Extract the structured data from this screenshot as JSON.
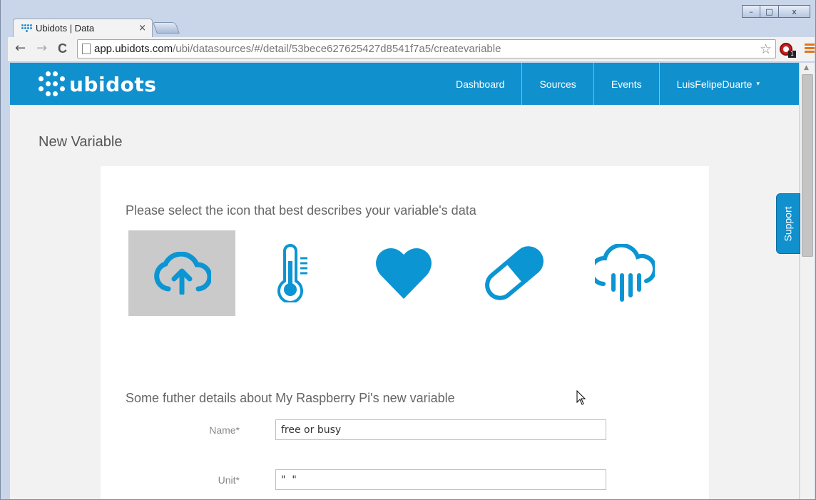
{
  "browser": {
    "tab_title": "Ubidots | Data",
    "tab_close": "×",
    "url_host": "app.ubidots.com",
    "url_path": "/ubi/datasources/#/detail/53bece627625427d8541f7a5/createvariable",
    "window_controls": {
      "minimize": "–",
      "maximize": "□",
      "close": "x"
    },
    "nav": {
      "back": "←",
      "forward": "→",
      "reload": "C"
    },
    "extension_badge": "1"
  },
  "header": {
    "logo_text": "ubidots",
    "nav": {
      "dashboard": "Dashboard",
      "sources": "Sources",
      "events": "Events",
      "user": "LuisFelipeDuarte",
      "user_caret": "▾"
    }
  },
  "page": {
    "title": "New Variable",
    "icon_prompt": "Please select the icon that best describes your variable's data",
    "icons": [
      {
        "name": "cloud-upload-icon",
        "selected": true
      },
      {
        "name": "thermometer-icon",
        "selected": false
      },
      {
        "name": "heart-icon",
        "selected": false
      },
      {
        "name": "pill-icon",
        "selected": false
      },
      {
        "name": "rain-cloud-icon",
        "selected": false
      }
    ],
    "details_heading": "Some futher details about My Raspberry Pi's new variable",
    "form": {
      "name_label": "Name*",
      "name_value": "free or busy",
      "unit_label": "Unit*",
      "unit_value": "\"  \""
    }
  },
  "support_label": "Support",
  "colors": {
    "brand": "#1190ce",
    "icon": "#0c95d3",
    "selected_bg": "#cacaca",
    "page_bg": "#f2f2f2"
  }
}
